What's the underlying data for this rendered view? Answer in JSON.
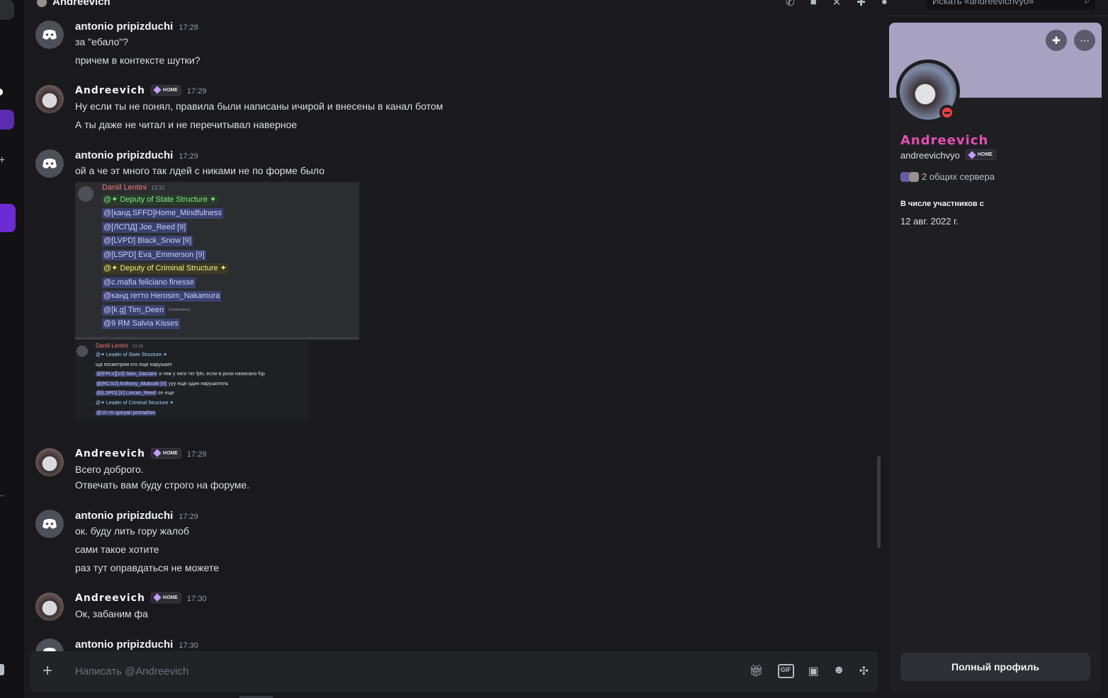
{
  "header": {
    "title": "Andreevich",
    "search_placeholder": "Искать «andreevichvyo»",
    "icons": [
      "phone-icon",
      "video-icon",
      "pin-icon",
      "add-friends-icon",
      "profile-toggle-icon",
      "search-icon"
    ]
  },
  "messages": [
    {
      "author": "antonio pripizduchi",
      "time": "17:28",
      "lines": [
        "за \"ебало\"?",
        "причем в контексте шутки?"
      ]
    },
    {
      "author": "Andreevich",
      "tag": "HOME",
      "time": "17:29",
      "lines": [
        "Ну если ты не понял, правила были написаны ичирой и внесены в канал ботом",
        "А ты даже не читал и не перечитывал наверное"
      ]
    },
    {
      "author": "antonio pripizduchi",
      "time": "17:29",
      "lines": [
        "ой а че эт много так лдей с никами не по форме было"
      ]
    },
    {
      "author": "Andreevich",
      "tag": "HOME",
      "time": "17:29",
      "lines": [
        "Всего доброго.",
        "Отвечать вам буду строго на форуме."
      ]
    },
    {
      "author": "antonio pripizduchi",
      "time": "17:29",
      "lines": [
        "ок. буду лить гору жалоб",
        "сами такое хотите",
        "раз тут оправдаться не можете"
      ]
    },
    {
      "author": "Andreevich",
      "tag": "HOME",
      "time": "17:30",
      "lines": [
        "Ок, забаним фа"
      ]
    },
    {
      "author": "antonio pripizduchi",
      "time": "17:30",
      "lines": []
    }
  ],
  "attachment1": {
    "author": "Daniil Lentini",
    "time": "13:31",
    "pings": [
      "@✦ Deputy of State Structure ✦",
      "@[канд.SFFD]Home_Mindfulness",
      "@[ЛСПД] Joe_Reed [9]",
      "@[LVPD] Black_Snow [9]",
      "@[LSPD] Eva_Emmerson [9]",
      "@✦ Deputy of Criminal Structure ✦",
      "@c.mafia feliciano finesse",
      "@канд гетто Herosim_Nakamura",
      "@[k.g] Tim_Deen",
      "@9 RM Salvia Kisses"
    ],
    "edited": "(изменено)"
  },
  "attachment2": {
    "author": "Daniil Lentini",
    "time": "13:28",
    "lines": [
      {
        "mention": "@✦ Leader of State Structure ✦",
        "text": ""
      },
      {
        "mention": "",
        "text": "ща посмотрим кто еще нарушает"
      },
      {
        "mention": "@[FPLV][10] Sam_Zaccaro",
        "text": " а чеж у него тег fplv, если в роли написано fsp"
      },
      {
        "mention": "@[RCSD] Anthony_Akatsuki [X]",
        "text": " ууу еще один нарушитель"
      },
      {
        "mention": "@[LSPD] [X] Lorcan_Reed",
        "text": " on еще"
      },
      {
        "mention": "@✦ Leader of Criminal Structure ✦",
        "text": ""
      },
      {
        "mention": "@10 rm igoryan promahov",
        "text": ""
      }
    ]
  },
  "composer": {
    "placeholder": "Написать @Andreevich",
    "icons": [
      "gift-icon",
      "gif-icon",
      "sticker-icon",
      "emoji-icon",
      "apps-icon"
    ]
  },
  "profile": {
    "display_name": "Andreevich",
    "username": "andreevichvyo",
    "tag": "HOME",
    "mutual": "2 общих сервера",
    "member_since_label": "В числе участников с",
    "member_since": "12 авг. 2022 г.",
    "full_profile": "Полный профиль",
    "status": "do-not-disturb",
    "colors": {
      "name": "#e64fb2",
      "banner": "#a7a2c2",
      "dnd": "#f23f43"
    }
  }
}
